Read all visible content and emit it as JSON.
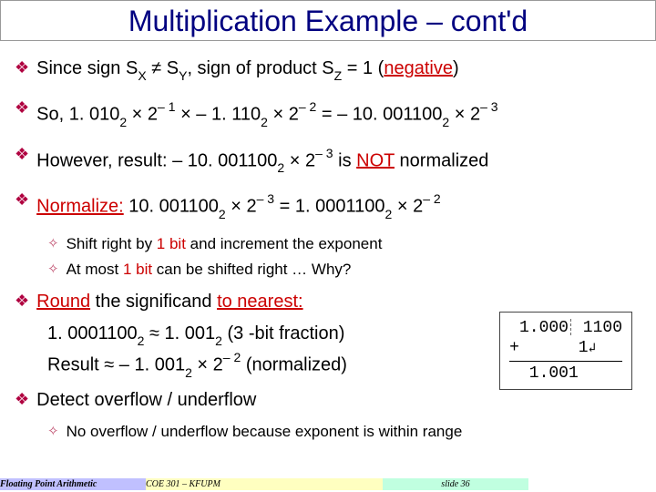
{
  "title": "Multiplication Example – cont'd",
  "line1": {
    "pre": "Since sign S",
    "sx": "X",
    "mid1": " ≠ S",
    "sy": "Y",
    "mid2": ", sign of product S",
    "sz": "Z",
    "eq": " = 1 (",
    "neg": "negative",
    "close": ")"
  },
  "line2": {
    "pre": "So, 1. 010",
    "s2a": "2",
    "t1": " × 2",
    "e1": "– 1",
    "t2": " × – 1. 110",
    "s2b": "2",
    "t3": " × 2",
    "e2": "– 2",
    "t4": " = – 10. 001100",
    "s2c": "2",
    "t5": " × 2",
    "e3": "– 3"
  },
  "line3": {
    "pre": "However, result: – 10. 001100",
    "s2": "2",
    "t1": " × 2",
    "e1": "– 3",
    "mid": " is ",
    "not": "NOT",
    "post": " normalized"
  },
  "line4": {
    "norm": "Normalize:",
    "t0": " 10. 001100",
    "s2a": "2",
    "t1": " × 2",
    "e1": "– 3",
    "eq": " = 1. 0001100",
    "s2b": "2",
    "t2": " × 2",
    "e2": "– 2"
  },
  "sub4a": {
    "pre": "Shift right by ",
    "one": "1 bit",
    "post": " and increment the exponent"
  },
  "sub4b": {
    "pre": "At most ",
    "one": "1 bit",
    "post": " can be shifted right … Why?"
  },
  "line5": {
    "round": "Round",
    "mid": " the significand ",
    "near": "to nearest:"
  },
  "line5a": {
    "pre": "1. 0001100",
    "s2a": "2",
    "mid": " ≈ 1. 001",
    "s2b": "2",
    "post": "  (3 -bit fraction)"
  },
  "line5b": {
    "pre": "Result ≈ – 1. 001",
    "s2": "2",
    "t1": " × 2",
    "e1": "– 2",
    "post": " (normalized)"
  },
  "box": {
    "l1a": " 1.000",
    "l1b": " 1100",
    "l2": "+      1",
    "l3": "  1.001"
  },
  "line6": "Detect overflow / underflow",
  "sub6": "No overflow / underflow because exponent is within range",
  "footer": {
    "f1": "Floating Point Arithmetic",
    "f2": "COE 301 – KFUPM",
    "f3": "slide 36"
  }
}
